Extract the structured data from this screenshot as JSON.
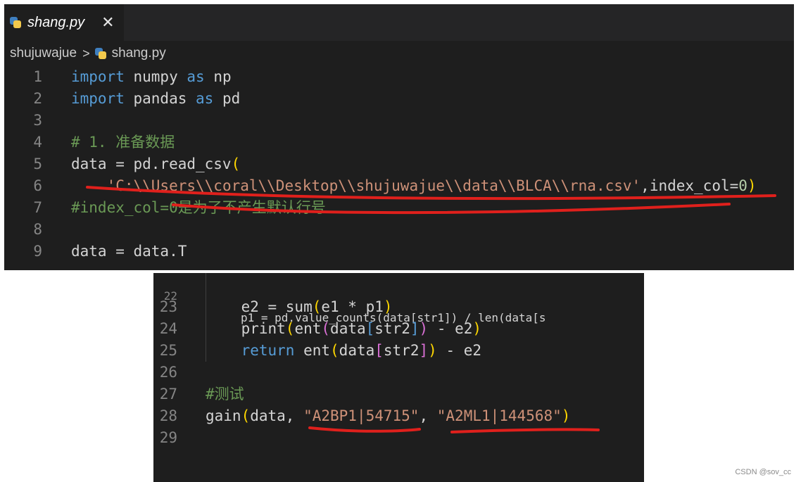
{
  "tab": {
    "filename": "shang.py",
    "close_glyph": "✕"
  },
  "breadcrumb": {
    "folder": "shujuwajue",
    "separator": ">",
    "file": "shang.py"
  },
  "top_lines": [
    {
      "n": "1",
      "parts": [
        [
          "kw",
          "import"
        ],
        [
          "",
          "&nbsp;numpy&nbsp;"
        ],
        [
          "kw",
          "as"
        ],
        [
          "",
          "&nbsp;np"
        ]
      ]
    },
    {
      "n": "2",
      "parts": [
        [
          "kw",
          "import"
        ],
        [
          "",
          "&nbsp;pandas&nbsp;"
        ],
        [
          "kw",
          "as"
        ],
        [
          "",
          "&nbsp;pd"
        ]
      ]
    },
    {
      "n": "3",
      "parts": []
    },
    {
      "n": "4",
      "parts": [
        [
          "cmt",
          "#&nbsp;1.&nbsp;准备数据"
        ]
      ]
    },
    {
      "n": "5",
      "parts": [
        [
          "",
          "data&nbsp;=&nbsp;pd.read_csv"
        ],
        [
          "paren",
          "("
        ]
      ]
    },
    {
      "n": "6",
      "parts": [
        [
          "",
          "&nbsp;&nbsp;&nbsp;&nbsp;"
        ],
        [
          "str",
          "'C:\\\\Users\\\\coral\\\\Desktop\\\\shujuwajue\\\\data\\\\BLCA\\\\rna.csv'"
        ],
        [
          "",
          ",index_col="
        ],
        [
          "num",
          "0"
        ],
        [
          "paren",
          ")"
        ]
      ]
    },
    {
      "n": "7",
      "parts": [
        [
          "cmt",
          "#index_col=0是为了不产生默认行号"
        ]
      ]
    },
    {
      "n": "8",
      "parts": []
    },
    {
      "n": "9",
      "parts": [
        [
          "",
          "data&nbsp;=&nbsp;data.T"
        ]
      ]
    }
  ],
  "bottom_partial": "p1 = pd.value_counts(data[str1]) / len(data[s",
  "bottom_partial_n": "22",
  "bottom_lines": [
    {
      "n": "23",
      "parts": [
        [
          "",
          "&nbsp;&nbsp;&nbsp;&nbsp;e2&nbsp;=&nbsp;sum"
        ],
        [
          "paren",
          "("
        ],
        [
          "",
          "e1&nbsp;*&nbsp;p1"
        ],
        [
          "paren",
          ")"
        ]
      ]
    },
    {
      "n": "24",
      "parts": [
        [
          "",
          "&nbsp;&nbsp;&nbsp;&nbsp;print"
        ],
        [
          "paren",
          "("
        ],
        [
          "",
          "ent"
        ],
        [
          "bracket",
          "("
        ],
        [
          "",
          "data"
        ],
        [
          "kw",
          "["
        ],
        [
          "",
          "str2"
        ],
        [
          "kw",
          "]"
        ],
        [
          "bracket",
          ")"
        ],
        [
          "",
          "&nbsp;-&nbsp;e2"
        ],
        [
          "paren",
          ")"
        ]
      ]
    },
    {
      "n": "25",
      "parts": [
        [
          "",
          "&nbsp;&nbsp;&nbsp;&nbsp;"
        ],
        [
          "kw",
          "return"
        ],
        [
          "",
          "&nbsp;ent"
        ],
        [
          "paren",
          "("
        ],
        [
          "",
          "data"
        ],
        [
          "bracket",
          "["
        ],
        [
          "",
          "str2"
        ],
        [
          "bracket",
          "]"
        ],
        [
          "paren",
          ")"
        ],
        [
          "",
          "&nbsp;-&nbsp;e2"
        ]
      ]
    },
    {
      "n": "26",
      "parts": []
    },
    {
      "n": "27",
      "parts": [
        [
          "cmt",
          "#测试"
        ]
      ]
    },
    {
      "n": "28",
      "parts": [
        [
          "",
          "gain"
        ],
        [
          "paren",
          "("
        ],
        [
          "",
          "data,&nbsp;"
        ],
        [
          "str",
          "\"A2BP1|54715\""
        ],
        [
          "",
          ",&nbsp;"
        ],
        [
          "str",
          "\"A2ML1|144568\""
        ],
        [
          "paren",
          ")"
        ]
      ]
    },
    {
      "n": "29",
      "parts": []
    }
  ],
  "watermark": "CSDN @sov_cc"
}
